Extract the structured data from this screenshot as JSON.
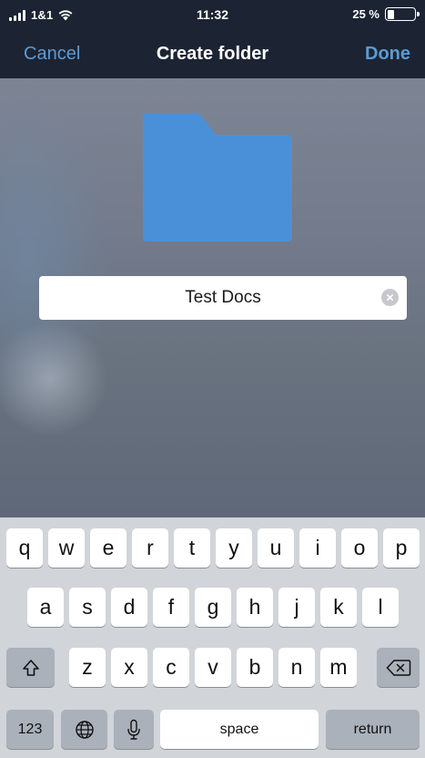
{
  "status_bar": {
    "carrier": "1&1",
    "time": "11:32",
    "battery_percent": "25 %",
    "battery_level": 0.25
  },
  "nav": {
    "cancel_label": "Cancel",
    "title": "Create folder",
    "done_label": "Done"
  },
  "folder_field": {
    "value": "Test Docs"
  },
  "colors": {
    "nav_background": "#1c2433",
    "accent_blue": "#5b9bd6",
    "folder_blue": "#4a90d9",
    "keyboard_background": "#d1d4d9"
  },
  "icons": {
    "folder": "folder-icon",
    "clear": "clear-text-icon",
    "shift": "shift-icon",
    "backspace": "backspace-icon",
    "globe": "globe-icon",
    "microphone": "microphone-icon"
  },
  "keyboard": {
    "row1": [
      "q",
      "w",
      "e",
      "r",
      "t",
      "y",
      "u",
      "i",
      "o",
      "p"
    ],
    "row2": [
      "a",
      "s",
      "d",
      "f",
      "g",
      "h",
      "j",
      "k",
      "l"
    ],
    "row3": [
      "z",
      "x",
      "c",
      "v",
      "b",
      "n",
      "m"
    ],
    "numbers_label": "123",
    "space_label": "space",
    "return_label": "return"
  }
}
